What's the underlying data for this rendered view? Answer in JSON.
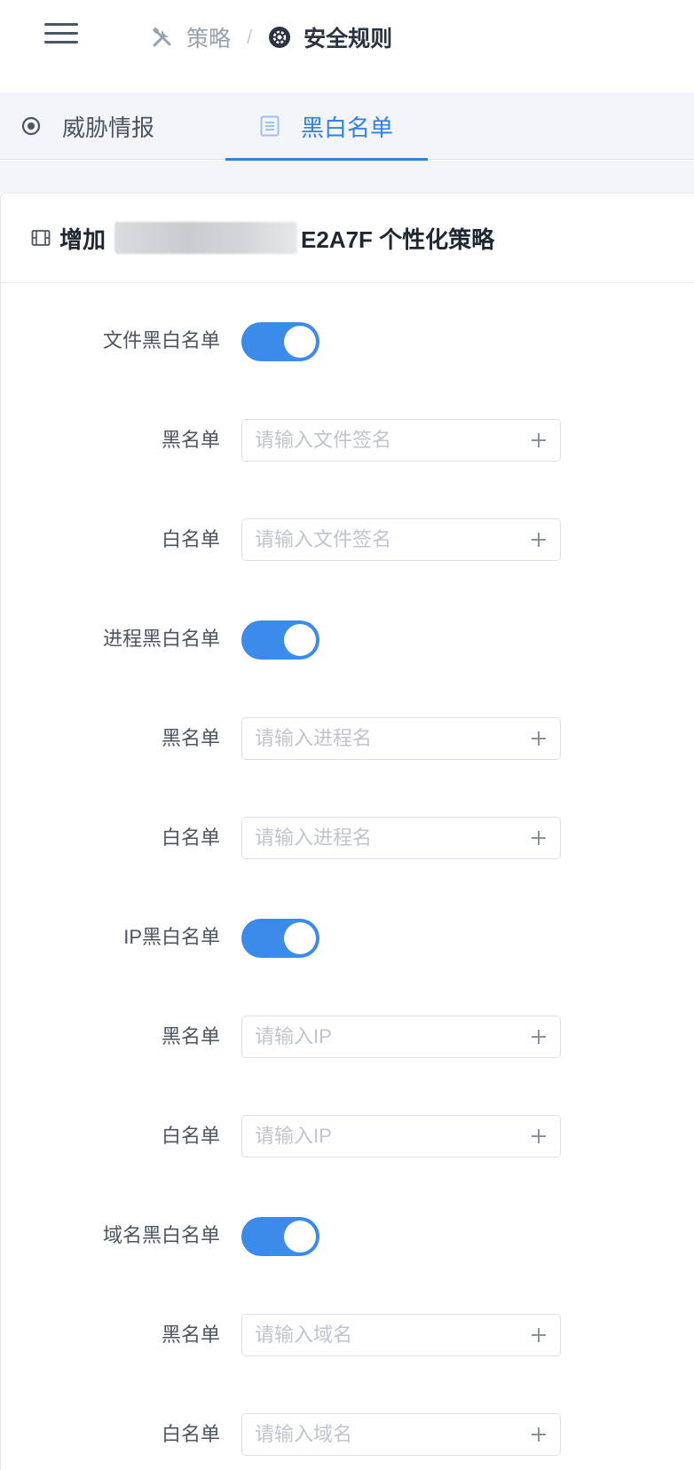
{
  "header": {
    "breadcrumb": [
      {
        "label": "策略",
        "icon": "tools-icon"
      },
      {
        "label": "安全规则",
        "icon": "shield-gear-icon"
      }
    ],
    "separator": "/"
  },
  "tabs": [
    {
      "label": "威胁情报",
      "icon": "target-icon",
      "active": false
    },
    {
      "label": "黑白名单",
      "icon": "list-icon",
      "active": true
    }
  ],
  "card": {
    "title_prefix": "增加",
    "title_suffix": "E2A7F 个性化策略"
  },
  "sections": [
    {
      "label": "文件黑白名单",
      "enabled": true,
      "black": {
        "label": "黑名单",
        "placeholder": "请输入文件签名",
        "value": ""
      },
      "white": {
        "label": "白名单",
        "placeholder": "请输入文件签名",
        "value": ""
      }
    },
    {
      "label": "进程黑白名单",
      "enabled": true,
      "black": {
        "label": "黑名单",
        "placeholder": "请输入进程名",
        "value": ""
      },
      "white": {
        "label": "白名单",
        "placeholder": "请输入进程名",
        "value": ""
      }
    },
    {
      "label": "IP黑白名单",
      "enabled": true,
      "black": {
        "label": "黑名单",
        "placeholder": "请输入IP",
        "value": ""
      },
      "white": {
        "label": "白名单",
        "placeholder": "请输入IP",
        "value": ""
      }
    },
    {
      "label": "域名黑白名单",
      "enabled": true,
      "black": {
        "label": "黑名单",
        "placeholder": "请输入域名",
        "value": ""
      },
      "white": {
        "label": "白名单",
        "placeholder": "请输入域名",
        "value": ""
      }
    }
  ],
  "colors": {
    "accent": "#2f80ed",
    "switch_on": "#3b8beb"
  }
}
